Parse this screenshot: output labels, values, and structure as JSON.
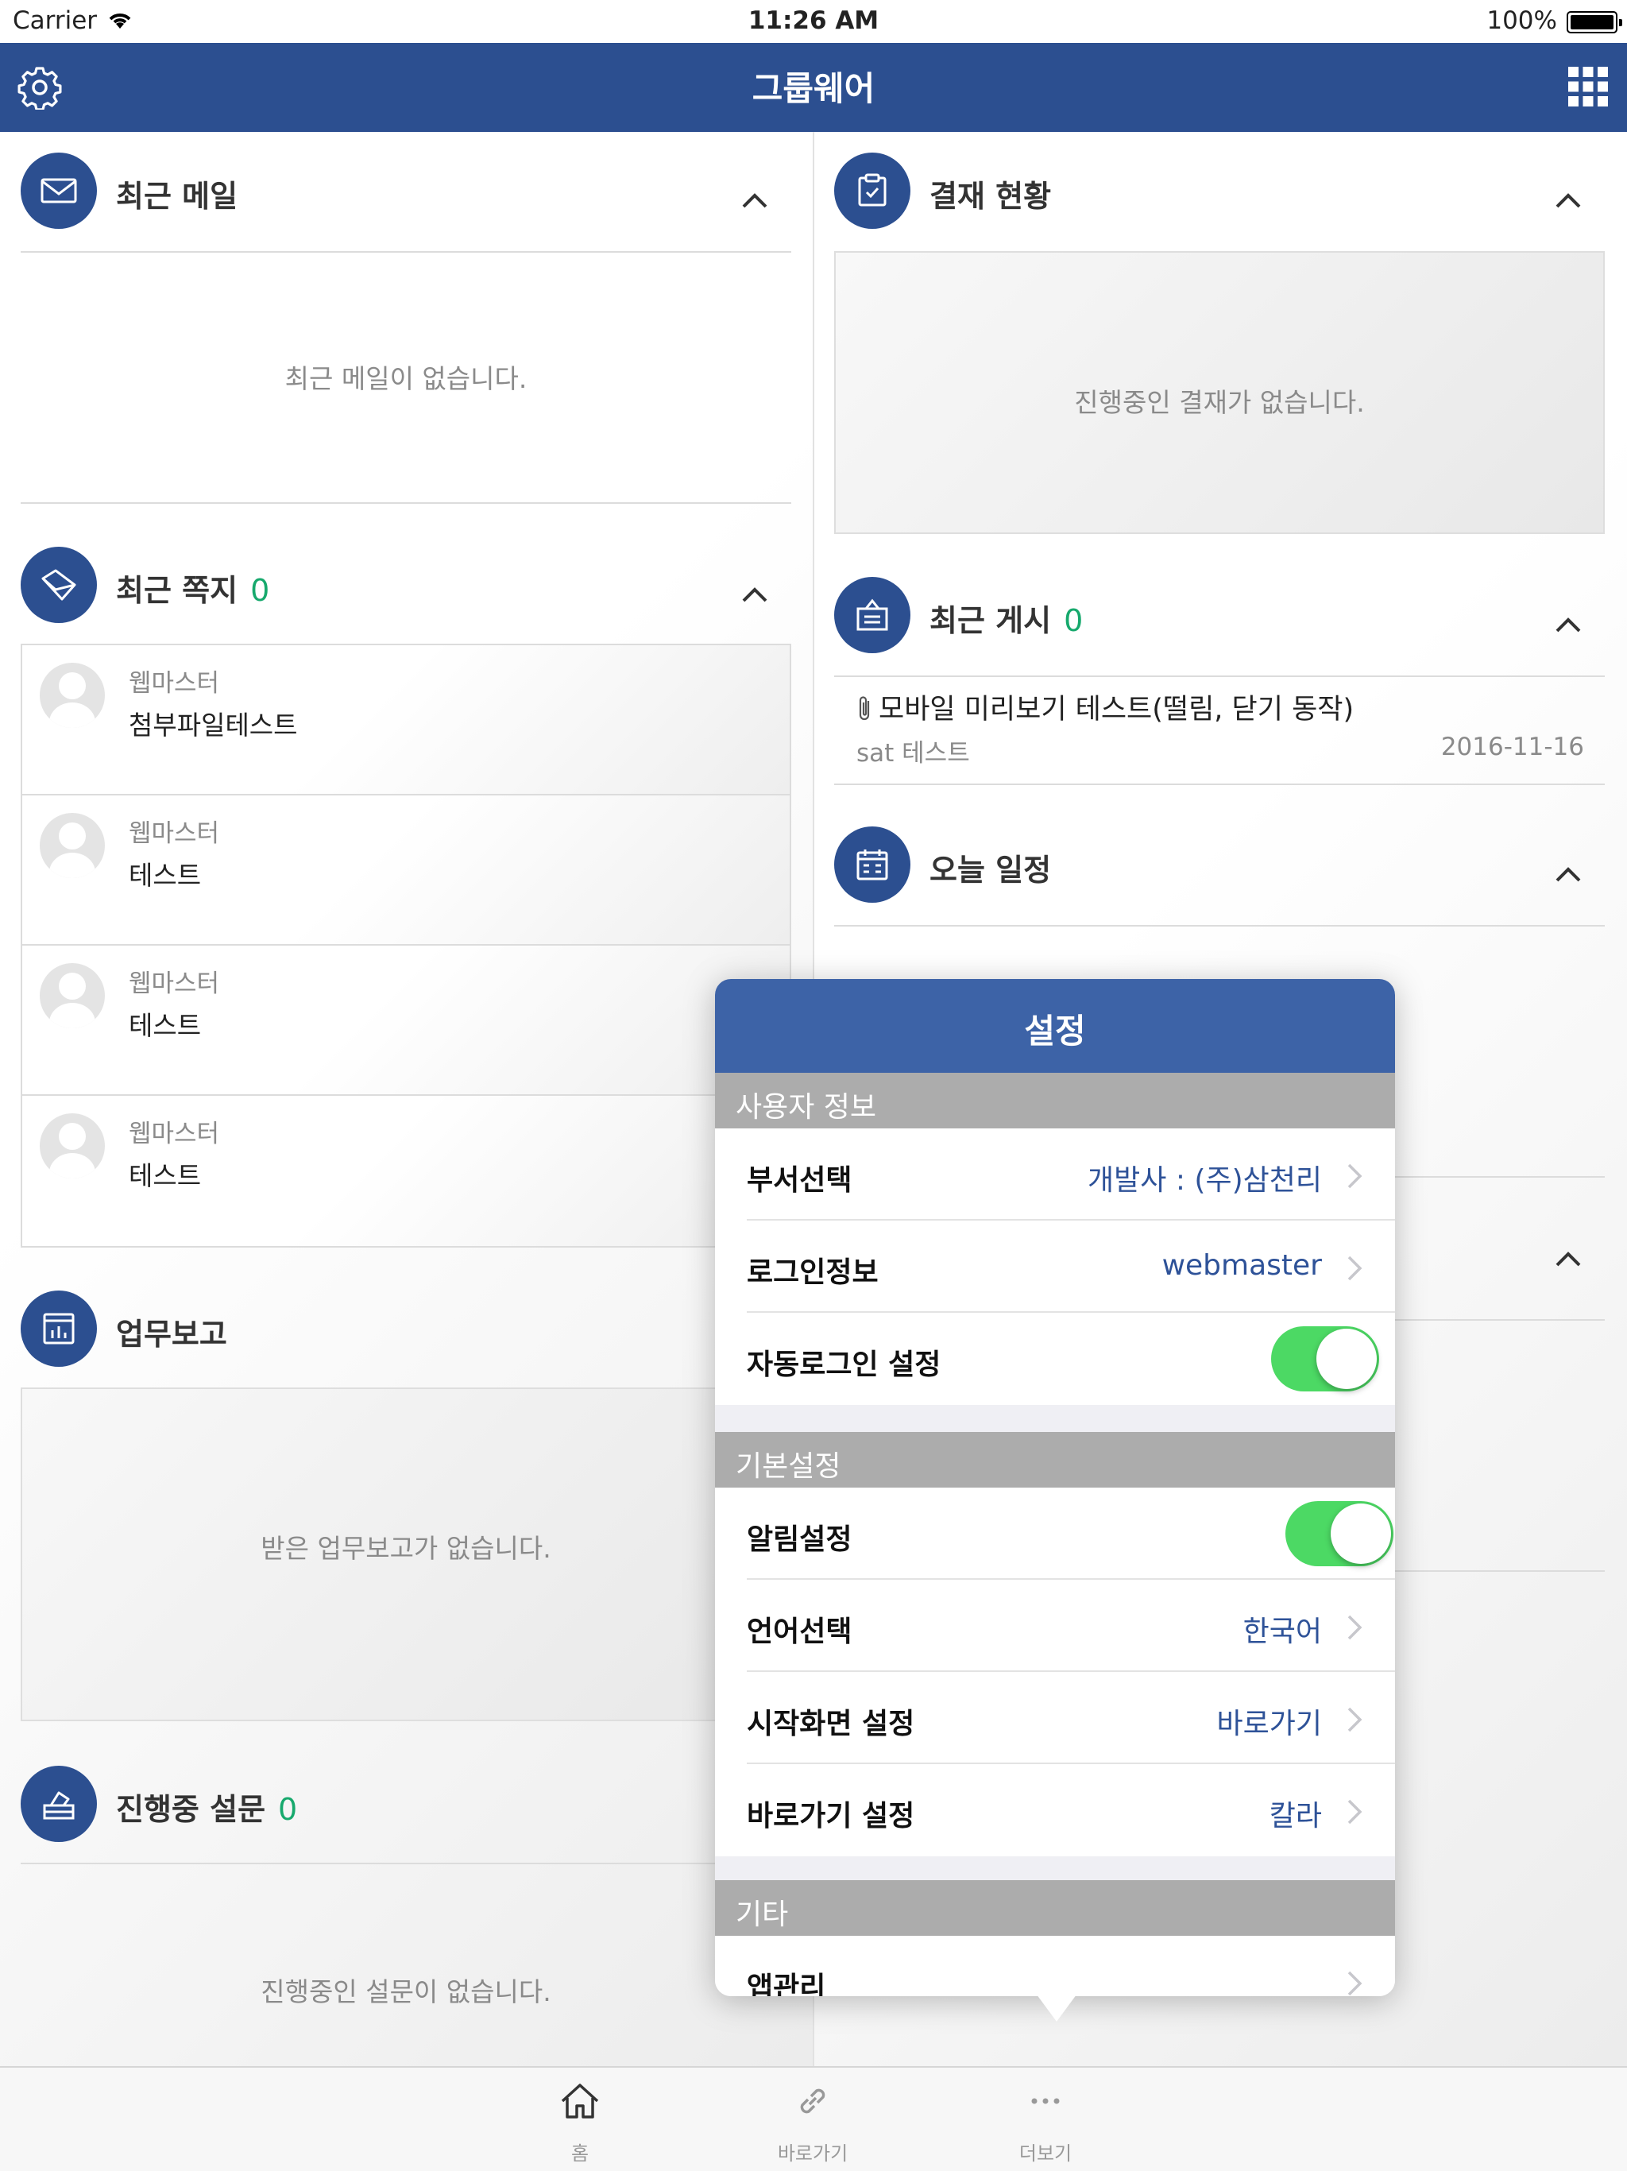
{
  "status_bar": {
    "carrier": "Carrier",
    "time": "11:26 AM",
    "battery": "100%"
  },
  "nav": {
    "title": "그룹웨어",
    "icons": [
      "gear-icon",
      "grid-icon"
    ]
  },
  "widgets": {
    "recent_mail": {
      "title": "최근 메일",
      "empty": "최근 메일이 없습니다."
    },
    "recent_notes": {
      "title": "최근 쪽지",
      "count": "0",
      "items": [
        {
          "sender": "웹마스터",
          "subject": "첨부파일테스트"
        },
        {
          "sender": "웹마스터",
          "subject": "테스트"
        },
        {
          "sender": "웹마스터",
          "subject": "테스트"
        },
        {
          "sender": "웹마스터",
          "subject": "테스트"
        }
      ]
    },
    "work_report": {
      "title": "업무보고",
      "empty": "받은 업무보고가 없습니다."
    },
    "survey": {
      "title": "진행중 설문",
      "count": "0",
      "empty": "진행중인 설문이 없습니다."
    },
    "approval": {
      "title": "결재 현황",
      "empty": "진행중인 결재가 없습니다."
    },
    "recent_posts": {
      "title": "최근 게시",
      "count": "0",
      "items": [
        {
          "title": "모바일 미리보기 테스트(떨림, 닫기 동작)",
          "author": "sat 테스트",
          "date": "2016-11-16"
        }
      ]
    },
    "today_schedule": {
      "title": "오늘 일정"
    }
  },
  "settings_popover": {
    "title": "설정",
    "sections": [
      {
        "header": "사용자 정보",
        "rows": [
          {
            "label": "부서선택",
            "value": "개발사 : (주)삼천리"
          },
          {
            "label": "로그인정보",
            "value": "webmaster"
          },
          {
            "label": "자동로그인 설정",
            "toggle": true
          }
        ]
      },
      {
        "header": "기본설정",
        "rows": [
          {
            "label": "알림설정",
            "toggle": true
          },
          {
            "label": "언어선택",
            "value": "한국어"
          },
          {
            "label": "시작화면 설정",
            "value": "바로가기"
          },
          {
            "label": "바로가기 설정",
            "value": "칼라"
          }
        ]
      },
      {
        "header": "기타",
        "rows": [
          {
            "label": "앱관리"
          }
        ]
      }
    ]
  },
  "tab_bar": {
    "items": [
      {
        "label": "홈",
        "icon": "home-icon"
      },
      {
        "label": "바로가기",
        "icon": "link-icon"
      },
      {
        "label": "더보기",
        "icon": "more-icon"
      }
    ]
  },
  "colors": {
    "primary": "#2c4f90",
    "popover_header": "#3d63a7",
    "accent_green": "#17a96d",
    "toggle_on": "#4cd964",
    "section_gray": "#acacac"
  }
}
